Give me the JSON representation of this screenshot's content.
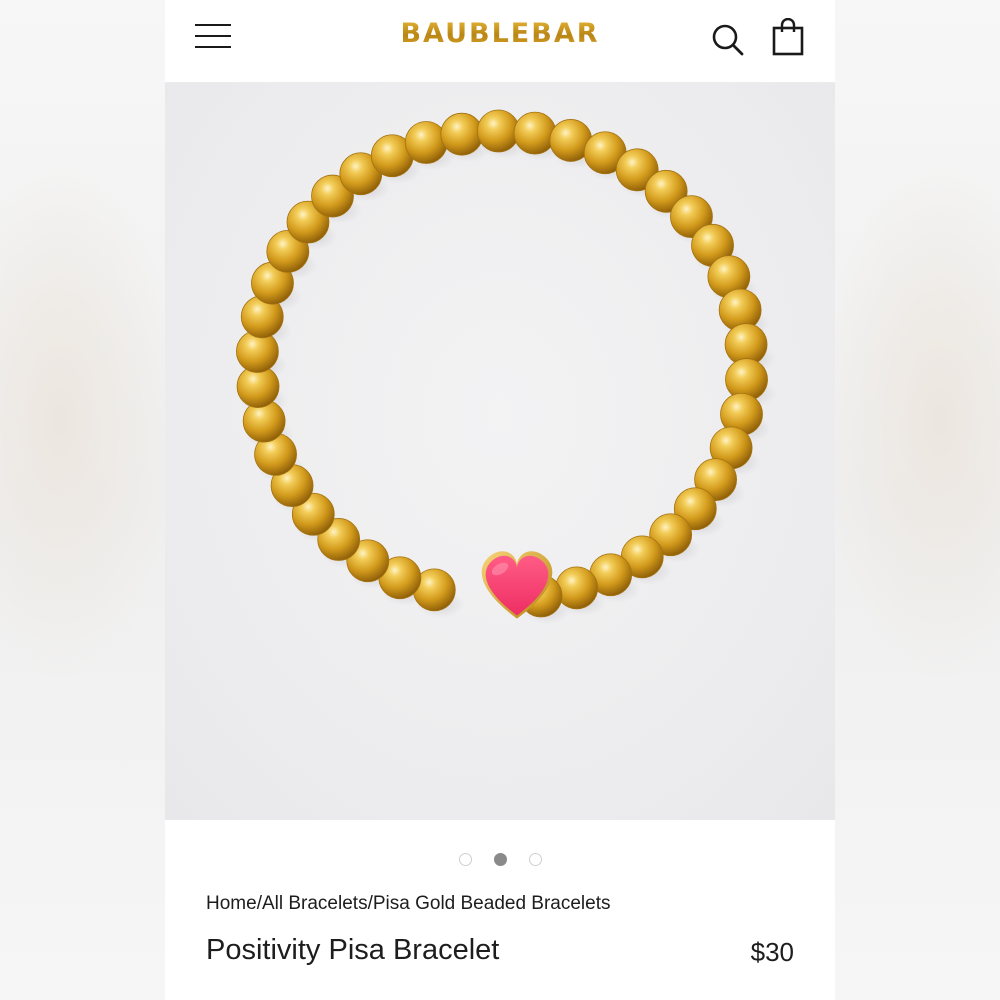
{
  "header": {
    "logo_text": "BAUBLEBAR",
    "menu_icon": "hamburger-menu-icon",
    "search_icon": "search-icon",
    "bag_icon": "shopping-bag-icon"
  },
  "carousel": {
    "total": 3,
    "active_index": 2
  },
  "breadcrumb": {
    "items": [
      "Home",
      "All Bracelets",
      "Pisa Gold Beaded Bracelets"
    ],
    "separator": "/"
  },
  "product": {
    "name": "Positivity Pisa Bracelet",
    "price": "$30",
    "bead_color": "#d9a227",
    "charm_color": "#f43b6f",
    "charm_icon": "heart-icon"
  }
}
